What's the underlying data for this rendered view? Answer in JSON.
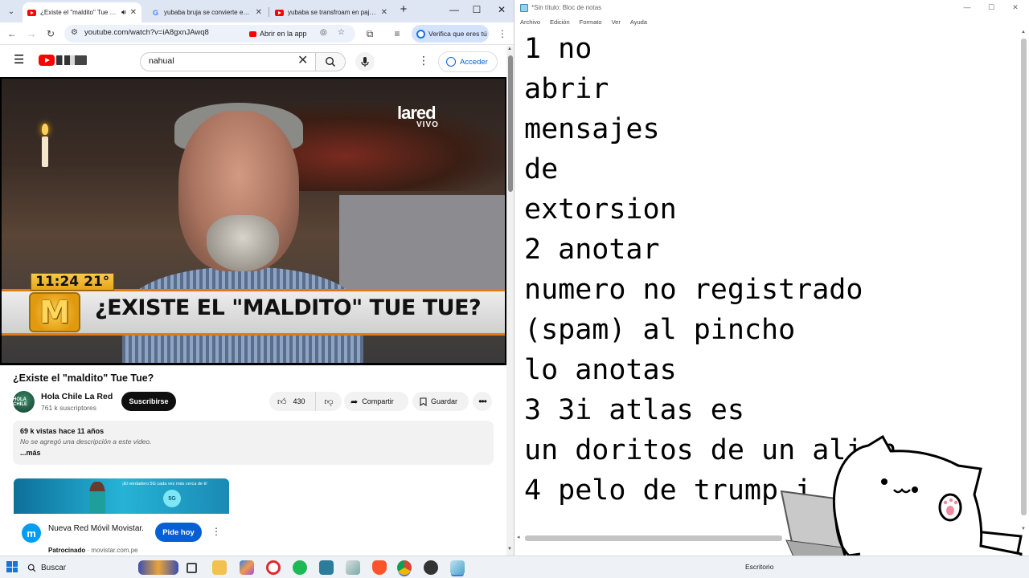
{
  "browser": {
    "tabs": [
      {
        "title": "¿Existe el \"maldito\" Tue Tue?",
        "favicon": "youtube-icon",
        "active": true,
        "audio": true
      },
      {
        "title": "yubaba bruja se convierte en ave",
        "favicon": "google-icon",
        "active": false
      },
      {
        "title": "yubaba se transfroam en pajaro",
        "favicon": "youtube-icon",
        "active": false
      }
    ],
    "url": "youtube.com/watch?v=iA8gxnJAwq8",
    "open_in_app": "Abrir en la app",
    "verify_label": "Verifica que eres tú"
  },
  "youtube": {
    "search_value": "nahual",
    "signin_label": "Acceder",
    "video": {
      "clock": "11:24",
      "temperature": "21°",
      "headline": "¿EXISTE EL \"MALDITO\" TUE TUE?",
      "channel_bug": "lared",
      "channel_bug_sub": "VIVO",
      "m_logo": "M"
    },
    "title": "¿Existe el \"maldito\" Tue Tue?",
    "channel": {
      "name": "Hola Chile La Red",
      "subscribers": "761 k suscriptores",
      "avatar_text": "HOLA CHILE"
    },
    "subscribe_label": "Suscribirse",
    "likes": "430",
    "share_label": "Compartir",
    "save_label": "Guardar",
    "description": {
      "stats": "69 k vistas  hace 11 años",
      "text": "No se agregó una descripción a este video.",
      "more": "...más"
    },
    "ad": {
      "banner_text": "¡El verdadero 5G cada vez más cerca de ti!",
      "badge": "5G",
      "logo_letter": "m",
      "title": "Nueva Red Móvil Movistar.",
      "sponsored": "Patrocinado",
      "domain": "movistar.com.pe",
      "cta": "Pide hoy"
    }
  },
  "notepad": {
    "title": "*Sin título: Bloc de notas",
    "menu": [
      "Archivo",
      "Edición",
      "Formato",
      "Ver",
      "Ayuda"
    ],
    "lines": [
      "1 no",
      "abrir",
      "mensajes",
      "de",
      "extorsion",
      "2 anotar",
      "numero no registrado",
      "(spam) al pincho",
      "lo anotas",
      "3 3i atlas es",
      "un doritos de un alien",
      "4 pelo de trump i"
    ]
  },
  "taskbar": {
    "search_label": "Buscar",
    "desktop_label": "Escritorio"
  },
  "colors": {
    "youtube_red": "#ff0000",
    "link_blue": "#065fd4",
    "taskbar_bg": "#eef2f7"
  }
}
